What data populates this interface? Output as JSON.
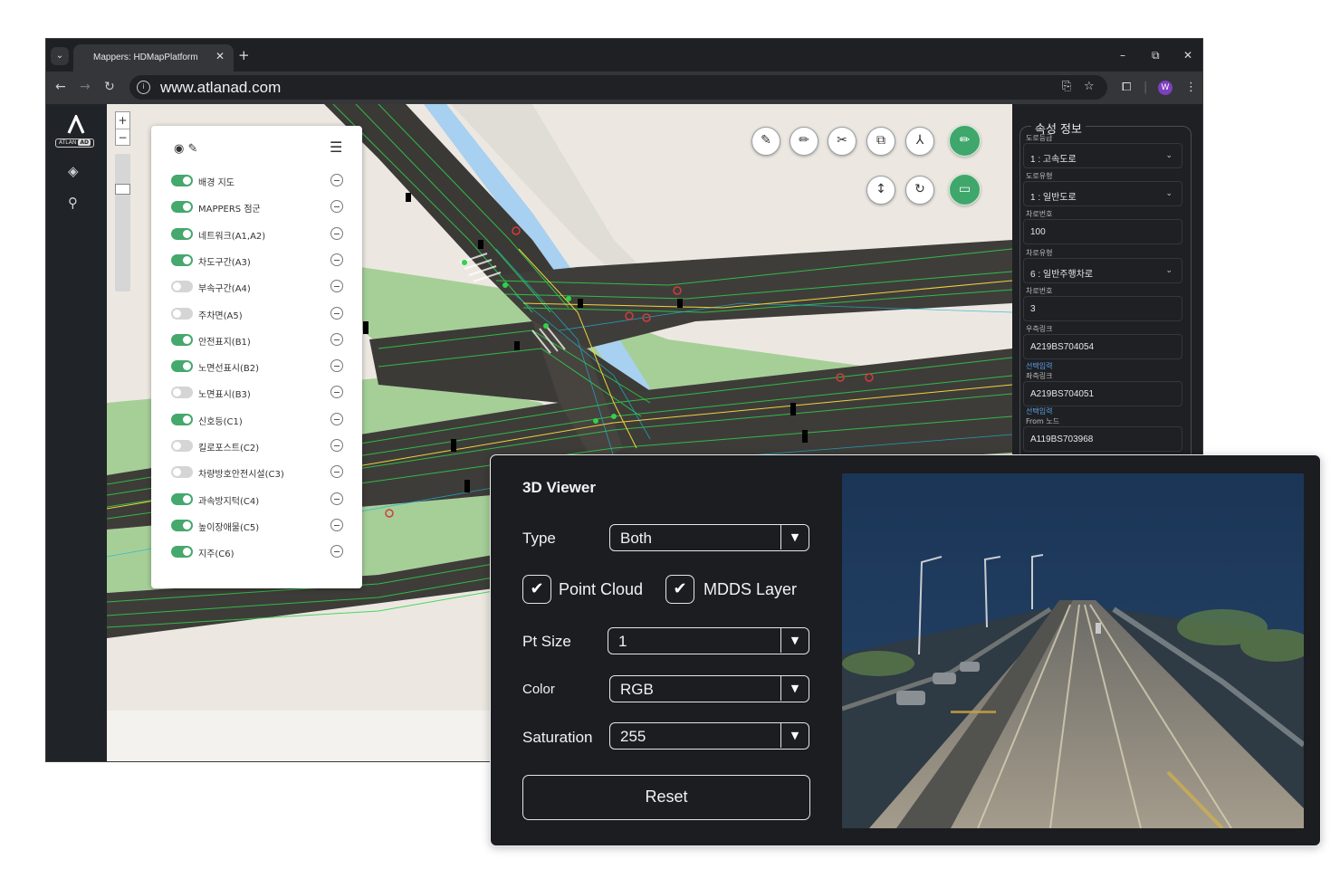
{
  "browser": {
    "tab_title": "Mappers: HDMapPlatform",
    "url": "www.atlanad.com",
    "avatar_letter": "W"
  },
  "app": {
    "logo_text": "ATLAN",
    "logo_badge": "AD"
  },
  "layer_panel": {
    "layers": [
      {
        "label": "배경 지도",
        "on": true
      },
      {
        "label": "MAPPERS 점군",
        "on": true
      },
      {
        "label": "네트워크(A1,A2)",
        "on": true
      },
      {
        "label": "차도구간(A3)",
        "on": true
      },
      {
        "label": "부속구간(A4)",
        "on": false
      },
      {
        "label": "주차면(A5)",
        "on": false
      },
      {
        "label": "안전표지(B1)",
        "on": true
      },
      {
        "label": "노면선표시(B2)",
        "on": true
      },
      {
        "label": "노면표시(B3)",
        "on": false
      },
      {
        "label": "신호등(C1)",
        "on": true
      },
      {
        "label": "킬로포스트(C2)",
        "on": false
      },
      {
        "label": "차량방호안전시설(C3)",
        "on": false
      },
      {
        "label": "과속방지턱(C4)",
        "on": true
      },
      {
        "label": "높이장애물(C5)",
        "on": true
      },
      {
        "label": "지주(C6)",
        "on": true
      }
    ]
  },
  "properties": {
    "title": "속성 정보",
    "fields": [
      {
        "label": "도로등급",
        "value": "1 : 고속도로",
        "dropdown": true
      },
      {
        "label": "도로유형",
        "value": "1 : 일반도로",
        "dropdown": true
      },
      {
        "label": "차로번호",
        "value": "100",
        "dropdown": false
      },
      {
        "label": "차로유형",
        "value": "6 : 일반주행차로",
        "dropdown": true
      },
      {
        "label": "차로번호",
        "value": "3",
        "dropdown": false
      },
      {
        "label": "우측링크",
        "value": "A219BS704054",
        "dropdown": false
      },
      {
        "label": "좌측링크",
        "sublabel": "선택입력",
        "value": "A219BS704051",
        "dropdown": false
      },
      {
        "label": "From 노드",
        "sublabel": "선택입력",
        "value": "A119BS703968",
        "dropdown": false
      }
    ]
  },
  "viewer": {
    "title": "3D Viewer",
    "type_label": "Type",
    "type_value": "Both",
    "point_cloud_label": "Point Cloud",
    "point_cloud_checked": true,
    "mdds_label": "MDDS Layer",
    "mdds_checked": true,
    "pt_size_label": "Pt Size",
    "pt_size_value": "1",
    "color_label": "Color",
    "color_value": "RGB",
    "saturation_label": "Saturation",
    "saturation_value": "255",
    "reset_label": "Reset"
  },
  "colors": {
    "toggle_on": "#45a86d",
    "map_bg": "#ece8e1",
    "grass": "#a6cf98",
    "water": "#a8d0f0",
    "accent_green": "#3fa76b"
  }
}
